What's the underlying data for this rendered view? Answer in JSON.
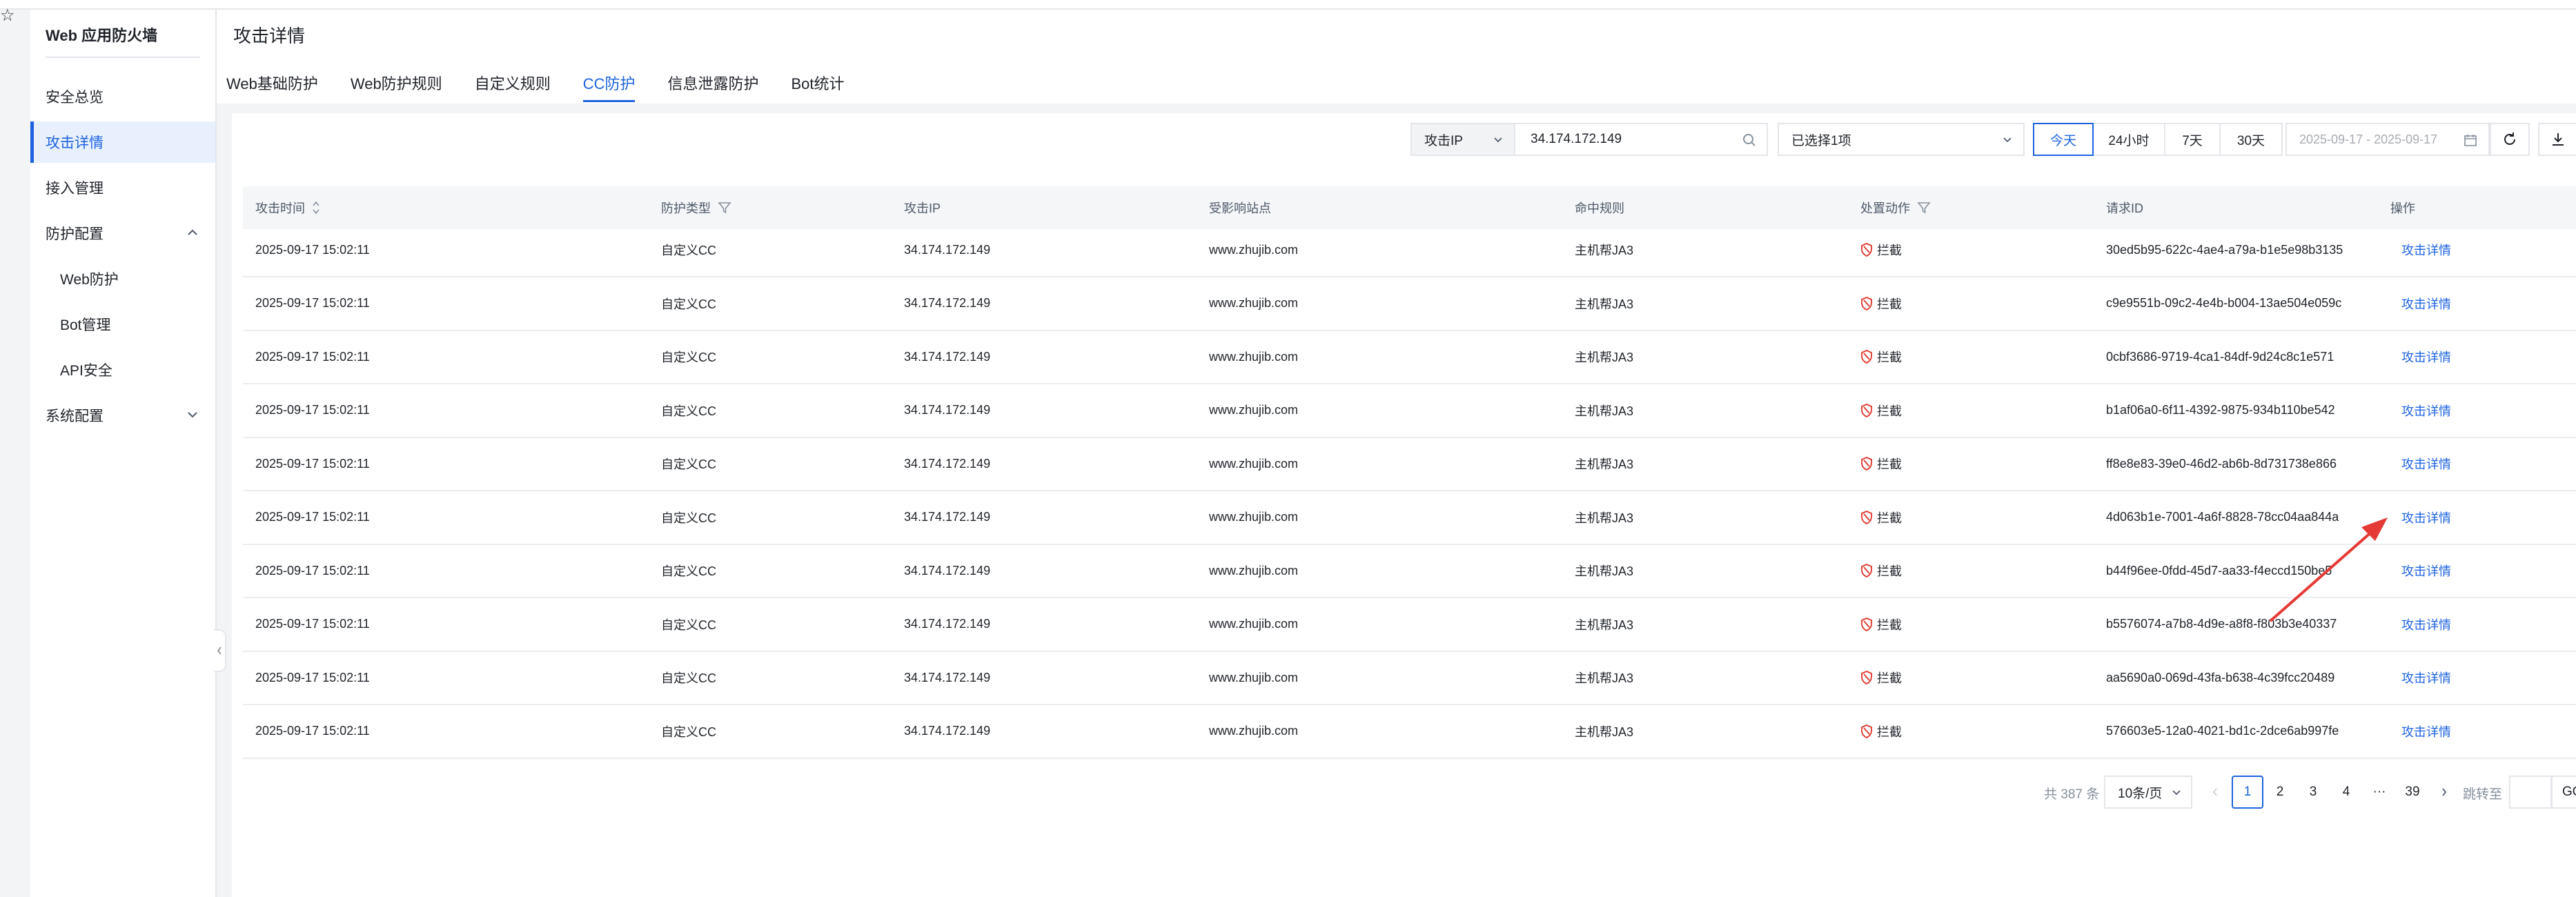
{
  "top": {
    "corner_icon": "☆"
  },
  "sidebar": {
    "title": "Web 应用防火墙",
    "items": [
      {
        "label": "安全总览",
        "active": false
      },
      {
        "label": "攻击详情",
        "active": true
      },
      {
        "label": "接入管理",
        "active": false
      },
      {
        "label": "防护配置",
        "expanded": true
      },
      {
        "label": "Web防护"
      },
      {
        "label": "Bot管理"
      },
      {
        "label": "API安全"
      },
      {
        "label": "系统配置",
        "expanded": false
      }
    ]
  },
  "header": {
    "title": "攻击详情",
    "tabs": [
      {
        "label": "Web基础防护"
      },
      {
        "label": "Web防护规则"
      },
      {
        "label": "自定义规则"
      },
      {
        "label": "CC防护",
        "active": true
      },
      {
        "label": "信息泄露防护"
      },
      {
        "label": "Bot统计"
      }
    ]
  },
  "filters": {
    "search_type": "攻击IP",
    "search_value": "34.174.172.149",
    "select_value": "已选择1项",
    "ranges": [
      "今天",
      "24小时",
      "7天",
      "30天"
    ],
    "active_range": "今天",
    "date_range": "2025-09-17 - 2025-09-17"
  },
  "table": {
    "columns": [
      "攻击时间",
      "防护类型",
      "攻击IP",
      "受影响站点",
      "命中规则",
      "处置动作",
      "请求ID",
      "操作"
    ],
    "rows": [
      {
        "time": "2025-09-17 15:02:11",
        "type": "自定义CC",
        "ip": "34.174.172.149",
        "site": "www.zhujib.com",
        "rule": "主机帮JA3",
        "action": "拦截",
        "req_id": "30ed5b95-622c-4ae4-a79a-b1e5e98b3135",
        "op": "攻击详情"
      },
      {
        "time": "2025-09-17 15:02:11",
        "type": "自定义CC",
        "ip": "34.174.172.149",
        "site": "www.zhujib.com",
        "rule": "主机帮JA3",
        "action": "拦截",
        "req_id": "c9e9551b-09c2-4e4b-b004-13ae504e059c",
        "op": "攻击详情"
      },
      {
        "time": "2025-09-17 15:02:11",
        "type": "自定义CC",
        "ip": "34.174.172.149",
        "site": "www.zhujib.com",
        "rule": "主机帮JA3",
        "action": "拦截",
        "req_id": "0cbf3686-9719-4ca1-84df-9d24c8c1e571",
        "op": "攻击详情"
      },
      {
        "time": "2025-09-17 15:02:11",
        "type": "自定义CC",
        "ip": "34.174.172.149",
        "site": "www.zhujib.com",
        "rule": "主机帮JA3",
        "action": "拦截",
        "req_id": "b1af06a0-6f11-4392-9875-934b110be542",
        "op": "攻击详情"
      },
      {
        "time": "2025-09-17 15:02:11",
        "type": "自定义CC",
        "ip": "34.174.172.149",
        "site": "www.zhujib.com",
        "rule": "主机帮JA3",
        "action": "拦截",
        "req_id": "ff8e8e83-39e0-46d2-ab6b-8d731738e866",
        "op": "攻击详情"
      },
      {
        "time": "2025-09-17 15:02:11",
        "type": "自定义CC",
        "ip": "34.174.172.149",
        "site": "www.zhujib.com",
        "rule": "主机帮JA3",
        "action": "拦截",
        "req_id": "4d063b1e-7001-4a6f-8828-78cc04aa844a",
        "op": "攻击详情"
      },
      {
        "time": "2025-09-17 15:02:11",
        "type": "自定义CC",
        "ip": "34.174.172.149",
        "site": "www.zhujib.com",
        "rule": "主机帮JA3",
        "action": "拦截",
        "req_id": "b44f96ee-0fdd-45d7-aa33-f4eccd150be5",
        "op": "攻击详情"
      },
      {
        "time": "2025-09-17 15:02:11",
        "type": "自定义CC",
        "ip": "34.174.172.149",
        "site": "www.zhujib.com",
        "rule": "主机帮JA3",
        "action": "拦截",
        "req_id": "b5576074-a7b8-4d9e-a8f8-f803b3e40337",
        "op": "攻击详情"
      },
      {
        "time": "2025-09-17 15:02:11",
        "type": "自定义CC",
        "ip": "34.174.172.149",
        "site": "www.zhujib.com",
        "rule": "主机帮JA3",
        "action": "拦截",
        "req_id": "aa5690a0-069d-43fa-b638-4c39fcc20489",
        "op": "攻击详情"
      },
      {
        "time": "2025-09-17 15:02:11",
        "type": "自定义CC",
        "ip": "34.174.172.149",
        "site": "www.zhujib.com",
        "rule": "主机帮JA3",
        "action": "拦截",
        "req_id": "576603e5-12a0-4021-bd1c-2dce6ab997fe",
        "op": "攻击详情"
      }
    ]
  },
  "pagination": {
    "total": "共 387 条",
    "page_size": "10条/页",
    "pages": [
      "1",
      "2",
      "3",
      "4",
      "···",
      "39"
    ],
    "current": "1",
    "jump_label": "跳转至",
    "go_label": "GO"
  },
  "colors": {
    "primary": "#1d63e0",
    "danger": "#e0352b",
    "annotation": "#e53935"
  }
}
